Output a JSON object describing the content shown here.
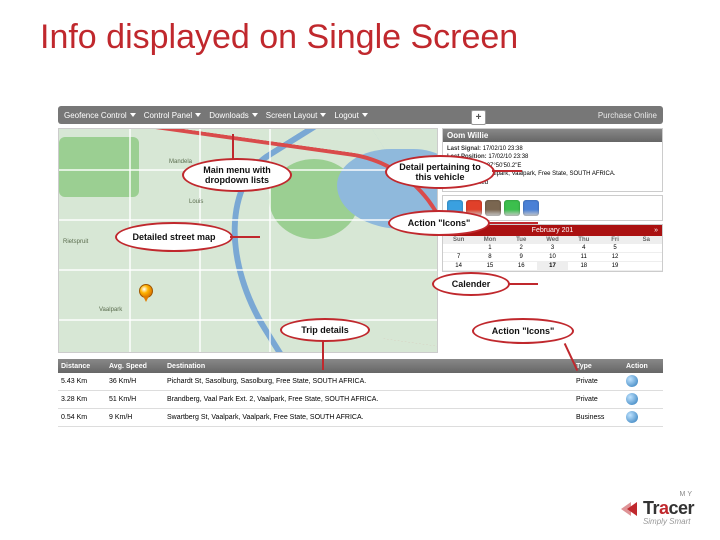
{
  "slide": {
    "title": "Info displayed on Single Screen"
  },
  "menu": {
    "items": [
      {
        "label": "Geofence Control"
      },
      {
        "label": "Control Panel"
      },
      {
        "label": "Downloads"
      },
      {
        "label": "Screen Layout"
      },
      {
        "label": "Logout"
      }
    ],
    "purchase": "Purchase Online"
  },
  "map": {
    "labels": {
      "a": "Vaalpark",
      "b": "Rietspruit",
      "c": "Louis",
      "d": "Mandela"
    },
    "zoom": "+"
  },
  "vehicle": {
    "panel_title": "Oom Willie",
    "last_signal_k": "Last Signal:",
    "last_signal_v": "17/02/10 23:38",
    "last_pos_k": "Last Position:",
    "last_pos_v": "17/02/10 23:38",
    "coords": "26°45'50.0\"S / 27°50'50.2\"E",
    "address": "Swartberg St, Vaalpark, Vaalpark, Free State, SOUTH AFRICA.",
    "status_k": "Status:",
    "status_v": "Parked"
  },
  "action_icons": {
    "colors": [
      "#3aa0e0",
      "#e0402a",
      "#7a6650",
      "#3cbf4d",
      "#4a80d6"
    ]
  },
  "calendar": {
    "title": "February 201",
    "prev": "«",
    "next": "»",
    "dow": [
      "Sun",
      "Mon",
      "Tue",
      "Wed",
      "Thu",
      "Fri",
      "Sa"
    ],
    "rows": [
      [
        "",
        "1",
        "2",
        "3",
        "4",
        "5",
        " "
      ],
      [
        "7",
        "8",
        "9",
        "10",
        "11",
        "12",
        " "
      ],
      [
        "14",
        "15",
        "16",
        "17",
        "18",
        "19",
        " "
      ]
    ],
    "selected": "17"
  },
  "trips": {
    "headers": {
      "dist": "Distance",
      "spd": "Avg. Speed",
      "dest": "Destination",
      "type": "Type",
      "act": "Action"
    },
    "rows": [
      {
        "dist": "5.43 Km",
        "spd": "36 Km/H",
        "dest": "Pichardt St, Sasolburg, Sasolburg, Free State, SOUTH AFRICA.",
        "type": "Private"
      },
      {
        "dist": "3.28 Km",
        "spd": "51 Km/H",
        "dest": "Brandberg, Vaal Park Ext. 2, Vaalpark, Free State, SOUTH AFRICA.",
        "type": "Private"
      },
      {
        "dist": "0.54 Km",
        "spd": "9 Km/H",
        "dest": "Swartberg St, Vaalpark, Vaalpark, Free State, SOUTH AFRICA.",
        "type": "Business"
      }
    ]
  },
  "callouts": {
    "menu": "Main menu with dropdown lists",
    "map": "Detailed street map",
    "vehicle": "Detail pertaining to this vehicle",
    "icons1": "Action \"Icons\"",
    "cal": "Calender",
    "trip": "Trip details",
    "icons2": "Action \"Icons\""
  },
  "brand": {
    "pre": "MY",
    "name1": "Tr",
    "name2": "a",
    "name3": "cer",
    "tag": "Simply Smart"
  }
}
